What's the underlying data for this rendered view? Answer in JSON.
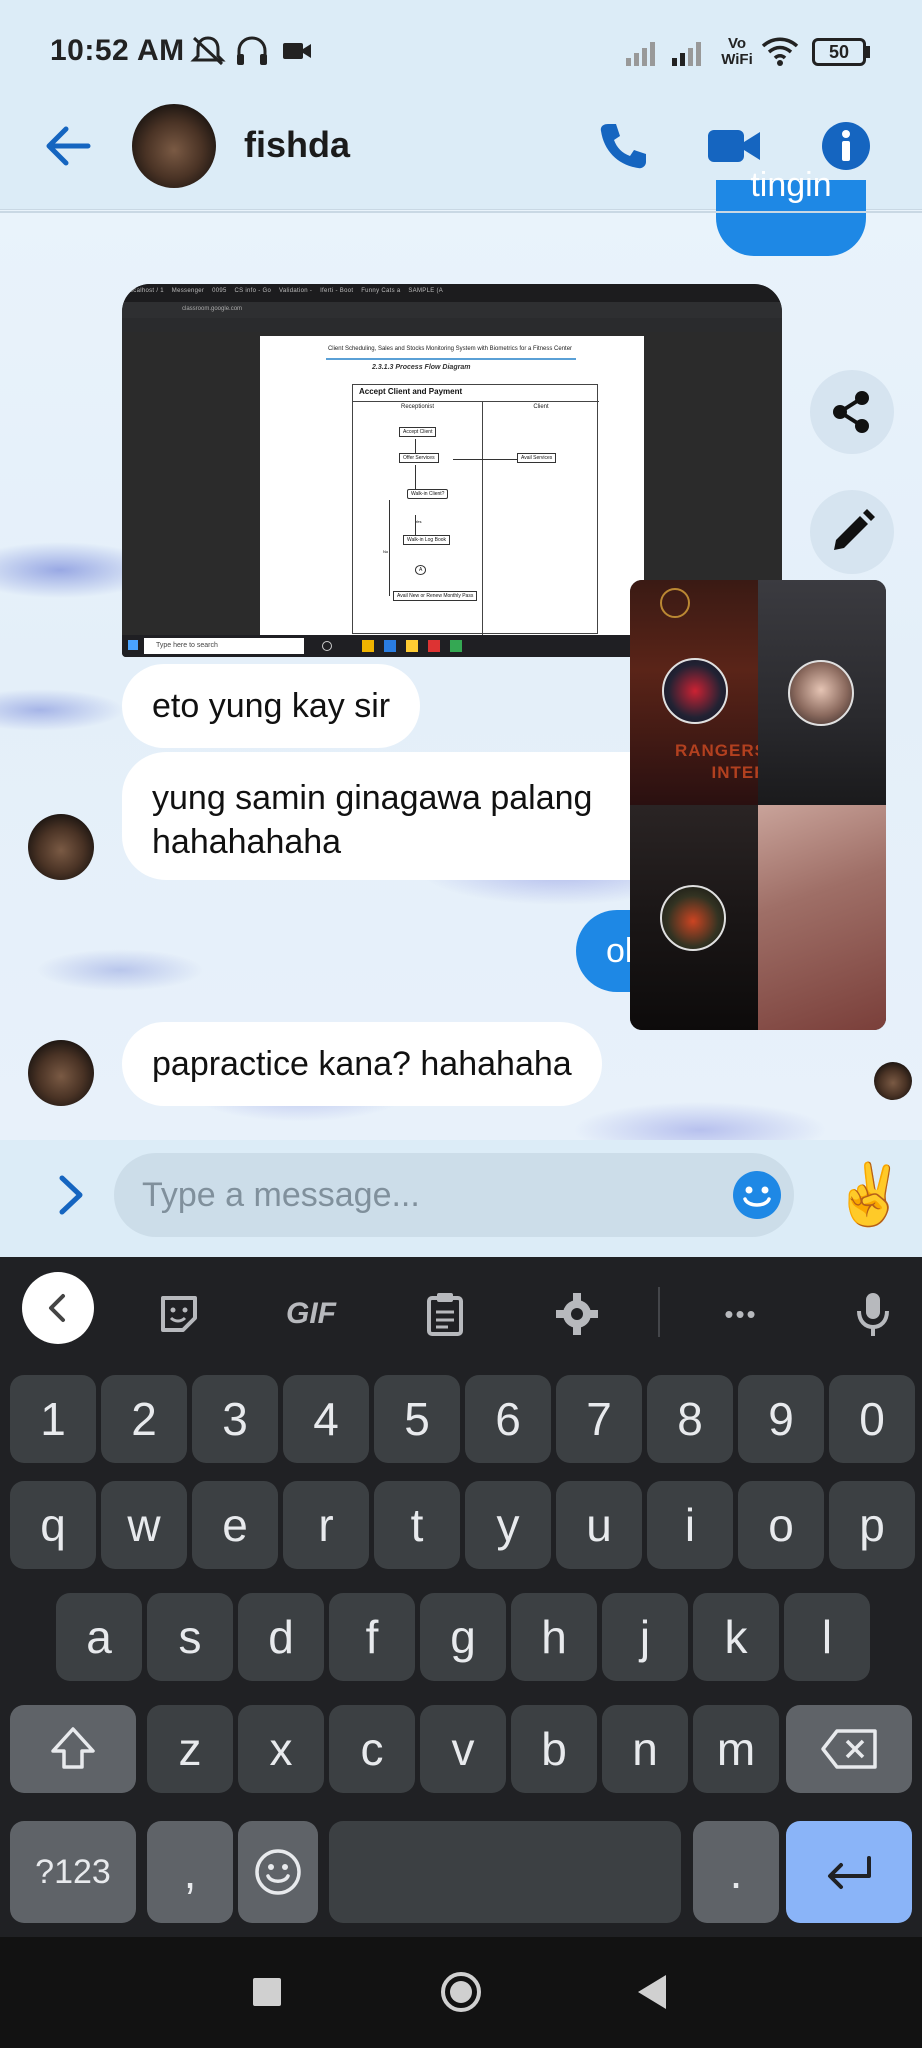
{
  "status_bar": {
    "time": "10:52 AM",
    "battery": "50",
    "network_label": "Vo WiFi",
    "icons": [
      "silent-icon",
      "headset-icon",
      "video-camera-icon",
      "signal-icon",
      "signal-icon",
      "vowifi-icon",
      "wifi-icon",
      "battery-icon"
    ]
  },
  "header": {
    "contact_name": "fishda",
    "icons": [
      "back-arrow-icon",
      "phone-icon",
      "video-call-icon",
      "info-icon"
    ],
    "accent_color": "#1565c0"
  },
  "messages": {
    "sent_partial": "tingin",
    "received_1": "eto yung kay sir",
    "received_2_line1": "yung samin ginagawa palang",
    "received_2_line2": "hahahahaha",
    "sent_partial_2": "ol",
    "received_3": "papractice kana? hahahaha"
  },
  "screenshot_attachment": {
    "doc_title": "Client Scheduling, Sales and Stocks Monitoring System with Biometrics for a Fitness Center",
    "section": "2.3.1.3 Process Flow Diagram",
    "box_title": "Accept Client and Payment",
    "lane_1": "Receptionist",
    "lane_2": "Client",
    "steps": [
      "Accept Client",
      "Offer Services",
      "Avail Services",
      "Walk-in Client?",
      "Yes",
      "No",
      "Walk-in Log Book",
      "A",
      "Avail New or Renew Monthly Pass"
    ],
    "search_text": "Type here to search",
    "tab_labels": [
      "localhost / 1",
      "Messenger",
      "0095",
      "CS info - Go",
      "Validation -",
      "Iferti - Boot",
      "Funny Cats a",
      "SAMPLE (A"
    ],
    "url": "classroom.google.com"
  },
  "video_call": {
    "banner_text": "RANGERS OF THE INTERNET"
  },
  "side_actions": {
    "icons": [
      "share-icon",
      "edit-icon"
    ]
  },
  "composer": {
    "placeholder": "Type a message...",
    "quick_reaction": "✌️",
    "icons": [
      "chevron-right-icon",
      "emoji-icon"
    ]
  },
  "keyboard": {
    "toolbar": [
      "back",
      "sticker",
      "GIF",
      "clipboard",
      "settings",
      "more",
      "mic"
    ],
    "gif_label": "GIF",
    "more_label": "•••",
    "row_numbers": [
      "1",
      "2",
      "3",
      "4",
      "5",
      "6",
      "7",
      "8",
      "9",
      "0"
    ],
    "row_1": [
      "q",
      "w",
      "e",
      "r",
      "t",
      "y",
      "u",
      "i",
      "o",
      "p"
    ],
    "row_2": [
      "a",
      "s",
      "d",
      "f",
      "g",
      "h",
      "j",
      "k",
      "l"
    ],
    "row_3": [
      "z",
      "x",
      "c",
      "v",
      "b",
      "n",
      "m"
    ],
    "symbols_label": "?123",
    "comma_label": ",",
    "period_label": ".",
    "key_bg": "#3c4043",
    "enter_bg": "#8ab4f8"
  }
}
